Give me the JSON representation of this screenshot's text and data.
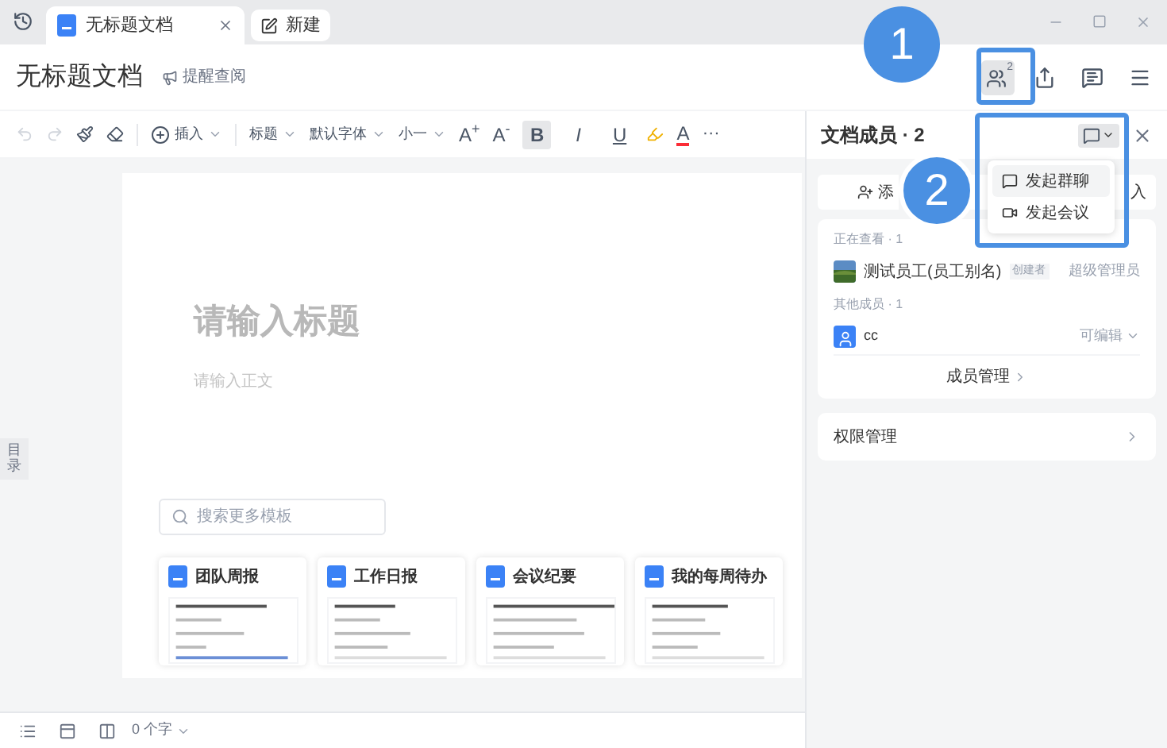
{
  "tabs": [
    {
      "label": "无标题文档",
      "selected": true
    },
    {
      "label": "新建",
      "selected": false
    }
  ],
  "header": {
    "title": "无标题文档",
    "remind": "提醒查阅",
    "member_count": "2"
  },
  "toolbar": {
    "insert": "插入",
    "style": "标题",
    "font": "默认字体",
    "size": "小一",
    "grow": "A$^{+}$",
    "shrink": "A$^{-}$",
    "font_color": "A",
    "more": "···",
    "format_buttons": [
      {
        "label": "B",
        "kind": "bold",
        "selected": true
      },
      {
        "label": "I",
        "kind": "italic",
        "selected": false
      },
      {
        "label": "U",
        "kind": "underline",
        "selected": false
      }
    ]
  },
  "outline_tab": "目录",
  "document": {
    "title_placeholder": "请输入标题",
    "body_placeholder": "请输入正文"
  },
  "templates": {
    "search_placeholder": "搜索更多模板",
    "items": [
      {
        "title": "团队周报"
      },
      {
        "title": "工作日报"
      },
      {
        "title": "会议纪要"
      },
      {
        "title": "我的每周待办"
      }
    ]
  },
  "status_bar": {
    "word_count": "0 个字"
  },
  "panel": {
    "title": "文档成员 · 2",
    "add_button": "添",
    "join_button": "入",
    "viewing_label": "正在查看 · 1",
    "viewers": [
      {
        "name": "测试员工(员工别名)",
        "badge": "创建者",
        "role": "超级管理员"
      }
    ],
    "others_label": "其他成员 · 1",
    "others": [
      {
        "name": "cc",
        "role": "可编辑"
      }
    ],
    "manage": "成员管理",
    "permissions": "权限管理"
  },
  "chat_menu": {
    "items": [
      {
        "label": "发起群聊",
        "kind": "chat",
        "selected": true
      },
      {
        "label": "发起会议",
        "kind": "video",
        "selected": false
      }
    ]
  },
  "annotations": [
    {
      "label": "1"
    },
    {
      "label": "2"
    }
  ]
}
